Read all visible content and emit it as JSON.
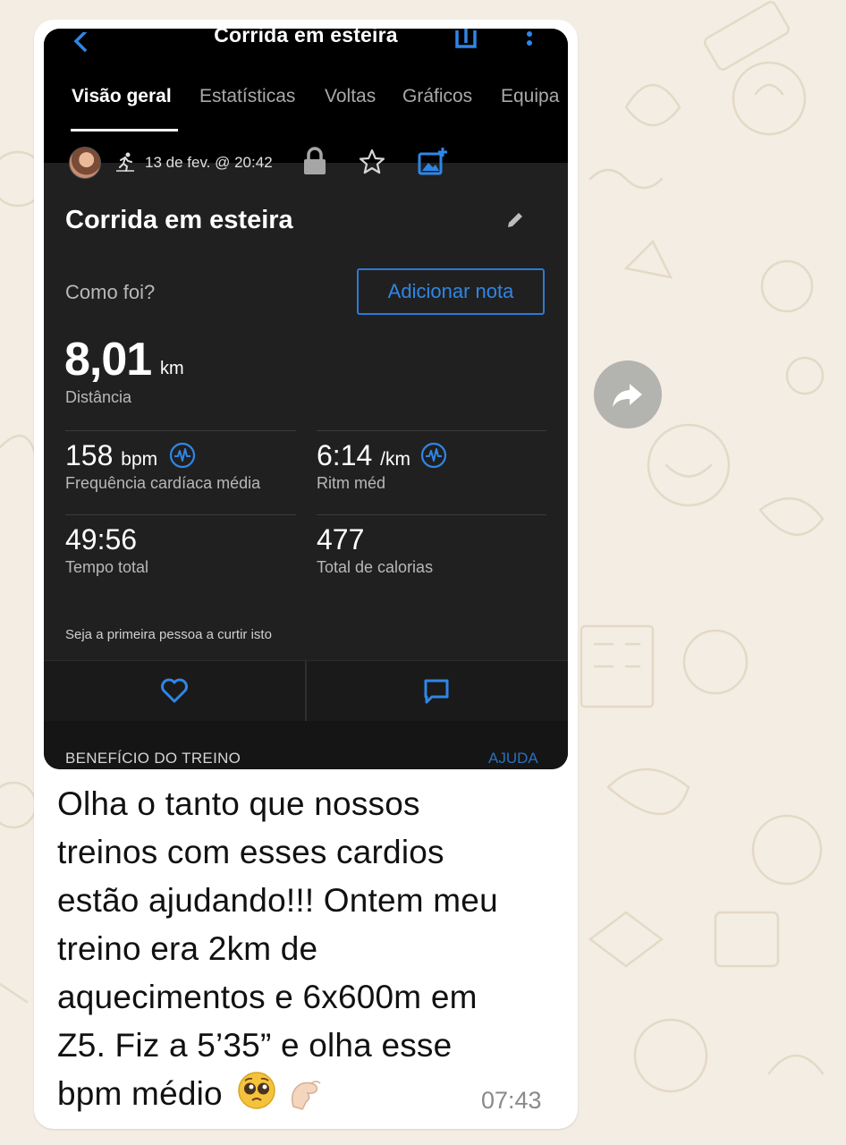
{
  "colors": {
    "accent": "#2f86e6",
    "panel": "#202020",
    "wallpaper": "#f3ede3"
  },
  "activity_screen": {
    "header_title": "Corrida em esteira",
    "icons": [
      "back-icon",
      "share-icon",
      "more-icon"
    ],
    "tabs": [
      "Visão geral",
      "Estatísticas",
      "Voltas",
      "Gráficos",
      "Equipa"
    ],
    "active_tab": "Visão geral",
    "meta": {
      "date": "13 de fev. @ 20:42",
      "icons": [
        "avatar",
        "run-icon",
        "lock-icon",
        "star-icon",
        "add-photo-icon"
      ]
    },
    "title": "Corrida em esteira",
    "how_label": "Como foi?",
    "add_note_label": "Adicionar nota",
    "distance": {
      "value": "8,01",
      "unit": "km",
      "label": "Distância"
    },
    "stats": [
      {
        "value": "158",
        "unit": "bpm",
        "label": "Frequência cardíaca média"
      },
      {
        "value": "6:14",
        "unit": "/km",
        "label": "Ritm méd"
      },
      {
        "value": "49:56",
        "unit": "",
        "label": "Tempo total"
      },
      {
        "value": "477",
        "unit": "",
        "label": "Total de calorias"
      }
    ],
    "like_prompt": "Seja a primeira pessoa a curtir isto",
    "section_title": "BENEFÍCIO DO TREINO",
    "help_label": "AJUDA"
  },
  "message": {
    "lines": [
      "Olha o tanto que nossos",
      "treinos com esses cardios",
      "estão ajudando!!! Ontem meu",
      "treino era 2km de",
      "aquecimentos e 6x600m em",
      "Z5. Fiz a 5’35” e olha esse",
      "bpm médio"
    ],
    "emojis": [
      "pleading-face",
      "pinching-hand"
    ],
    "time": "07:43"
  }
}
